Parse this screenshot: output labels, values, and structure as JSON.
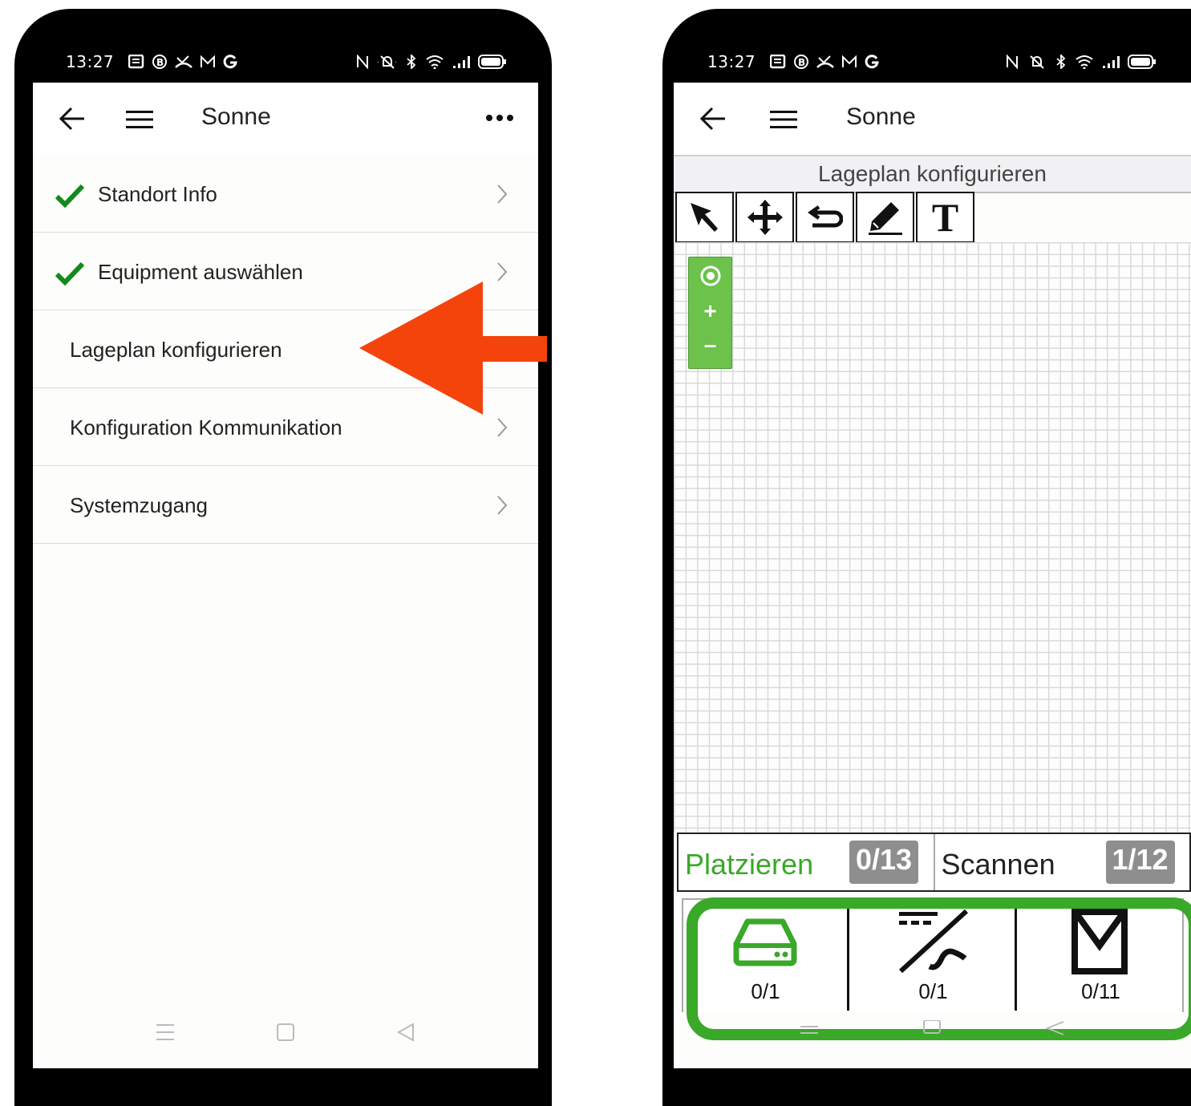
{
  "left": {
    "status": {
      "time": "13:27",
      "left_icons": [
        "notes-icon",
        "b-circle-icon",
        "call-missed-icon",
        "mail-icon",
        "google-icon"
      ],
      "right_icons": [
        "nfc-icon",
        "mute-icon",
        "bluetooth-icon",
        "wifi-icon",
        "signal-icon",
        "battery-icon"
      ]
    },
    "appbar": {
      "title": "Sonne"
    },
    "items": [
      {
        "label": "Standort Info",
        "checked": true
      },
      {
        "label": "Equipment auswählen",
        "checked": true
      },
      {
        "label": "Lageplan konfigurieren",
        "checked": false
      },
      {
        "label": "Konfiguration Kommunikation",
        "checked": false
      },
      {
        "label": "Systemzugang",
        "checked": false
      }
    ]
  },
  "right": {
    "status": {
      "time": "13:27"
    },
    "appbar": {
      "title": "Sonne"
    },
    "subheader": "Lageplan konfigurieren",
    "tools": [
      "select-arrow-icon",
      "move-icon",
      "undo-icon",
      "pen-icon",
      "text-icon"
    ],
    "text_tool_glyph": "T",
    "zoom": {
      "plus": "+",
      "minus": "–"
    },
    "tabs": [
      {
        "label": "Platzieren",
        "badge": "0/13",
        "color": "#3aa829"
      },
      {
        "label": "Scannen",
        "badge": "1/12",
        "color": "#222222"
      }
    ],
    "counters": [
      {
        "icon": "storage-device-icon",
        "text": "0/1"
      },
      {
        "icon": "inverter-icon",
        "text": "0/1"
      },
      {
        "icon": "solar-panel-icon",
        "text": "0/11"
      }
    ]
  },
  "colors": {
    "accent_green": "#3aa829",
    "arrow_red": "#f4440c",
    "check_green": "#138a1b"
  }
}
